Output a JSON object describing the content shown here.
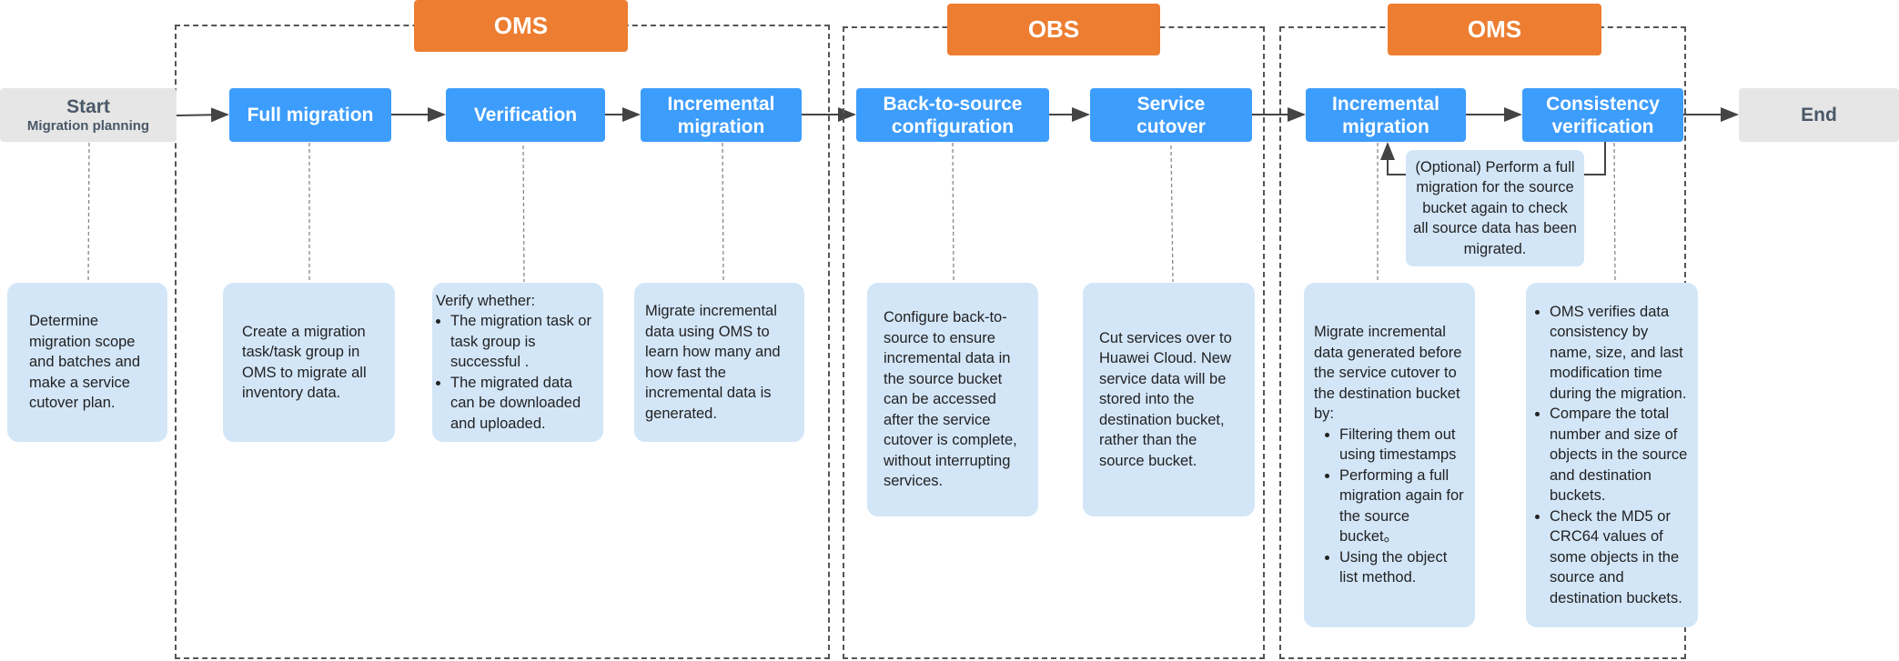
{
  "colors": {
    "group_label": "#ed7d31",
    "step": "#3d9dfc",
    "description": "#d3e6f8",
    "terminal": "#e6e6e6"
  },
  "groups": [
    {
      "label": "OMS"
    },
    {
      "label": "OBS"
    },
    {
      "label": "OMS"
    }
  ],
  "start": {
    "title": "Start",
    "subtitle": "Migration planning",
    "description": "Determine migration scope and batches and make a service cutover plan."
  },
  "end": {
    "title": "End"
  },
  "steps": [
    {
      "title": "Full migration",
      "description": "Create a migration task/task group in OMS to migrate all inventory data."
    },
    {
      "title": "Verification",
      "intro": "Verify whether:",
      "bullets": [
        "The migration task or task group is successful .",
        "The migrated data can be downloaded and uploaded."
      ]
    },
    {
      "title": "Incremental migration",
      "description": "Migrate incremental data using OMS to learn how many and how fast the incremental data is generated."
    },
    {
      "title": "Back-to-source configuration",
      "description": "Configure back-to-source to ensure incremental data in the source bucket can be accessed after the service cutover is complete, without interrupting services."
    },
    {
      "title": "Service cutover",
      "description": "Cut services over to Huawei Cloud. New service data will be stored into the destination bucket, rather than the source bucket."
    },
    {
      "title": "Incremental migration",
      "intro": "Migrate incremental data generated before the service cutover to the destination bucket by:",
      "bullets": [
        "Filtering them out using timestamps",
        "Performing a full migration again for the source bucket。",
        "Using the object list method."
      ]
    },
    {
      "title": "Consistency verification",
      "bullets": [
        "OMS verifies data consistency by name, size, and last modification time during the migration.",
        "Compare the total number and size of objects in the source and destination buckets.",
        "Check the MD5 or CRC64 values of some objects in the source and destination buckets."
      ]
    }
  ],
  "optional_loop": {
    "text": "(Optional) Perform a full migration for the source bucket again to check all source data has been migrated."
  }
}
